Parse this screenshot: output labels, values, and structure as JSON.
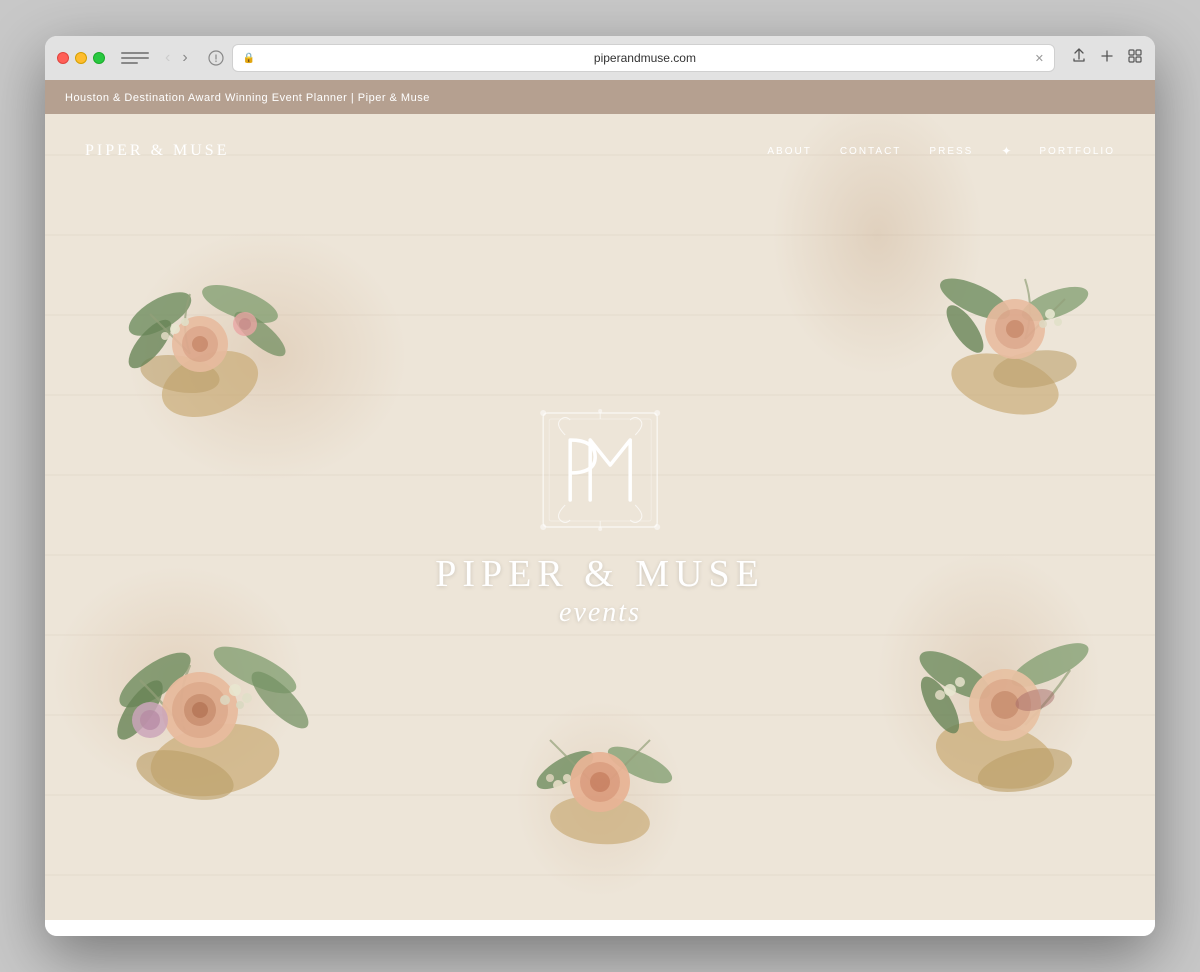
{
  "browser": {
    "url": "piperandmuse.com",
    "title": "Houston & Destination Award Winning Event Planner | Piper & Muse"
  },
  "site": {
    "announcement_bar": "Houston & Destination Award Winning Event Planner | Piper & Muse",
    "logo": "PIPER & MUSE",
    "brand_name": "PIPER & MUSE",
    "brand_sub": "events",
    "nav": {
      "items": [
        {
          "label": "ABOUT",
          "id": "about"
        },
        {
          "label": "CONTACT",
          "id": "contact"
        },
        {
          "label": "PRESS",
          "id": "press"
        },
        {
          "label": "PORTFOLIO",
          "id": "portfolio"
        }
      ]
    }
  }
}
